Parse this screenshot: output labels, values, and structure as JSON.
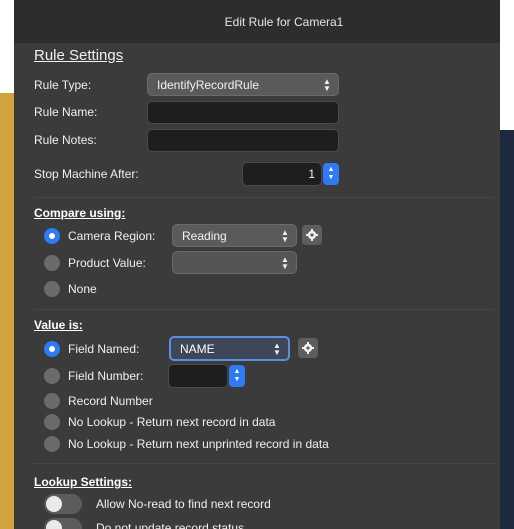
{
  "window": {
    "title": "Edit Rule for Camera1"
  },
  "rule_settings": {
    "title": "Rule Settings",
    "rule_type_label": "Rule Type:",
    "rule_type_value": "IdentifyRecordRule",
    "rule_name_label": "Rule Name:",
    "rule_name_value": "",
    "rule_notes_label": "Rule Notes:",
    "rule_notes_value": "",
    "stop_machine_label": "Stop Machine After:",
    "stop_machine_value": "1"
  },
  "compare_using": {
    "heading": "Compare using:",
    "options": [
      {
        "label": "Camera Region:",
        "selected": true
      },
      {
        "label": "Product Value:",
        "selected": false
      },
      {
        "label": "None",
        "selected": false
      }
    ],
    "camera_region_value": "Reading",
    "product_value_value": ""
  },
  "value_is": {
    "heading": "Value is:",
    "options": [
      {
        "label": "Field Named:",
        "selected": true
      },
      {
        "label": "Field Number:",
        "selected": false
      },
      {
        "label": "Record Number",
        "selected": false
      },
      {
        "label": "No Lookup - Return next record in data",
        "selected": false
      },
      {
        "label": "No Lookup - Return next unprinted record in data",
        "selected": false
      }
    ],
    "field_named_value": "NAME",
    "field_number_value": ""
  },
  "lookup_settings": {
    "heading": "Lookup Settings:",
    "toggles": [
      {
        "label": "Allow No-read to find next record",
        "on": false
      },
      {
        "label": "Do not update record status",
        "on": false
      }
    ]
  },
  "colors": {
    "accent": "#2f7bf5",
    "window_bg": "#3b3b3b",
    "titlebar_bg": "#2d2d2d"
  }
}
